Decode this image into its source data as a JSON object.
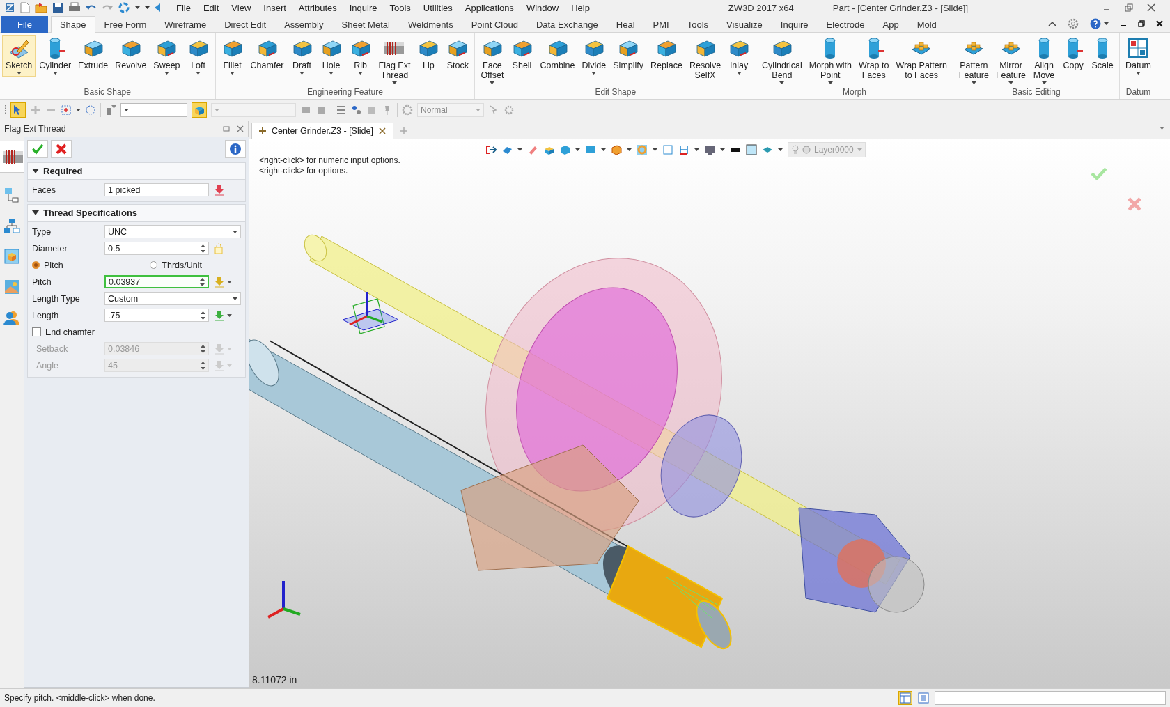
{
  "title_bar": {
    "menu": [
      "File",
      "Edit",
      "View",
      "Insert",
      "Attributes",
      "Inquire",
      "Tools",
      "Utilities",
      "Applications",
      "Window",
      "Help"
    ],
    "app_title": "ZW3D 2017  x64",
    "document_title": "Part - [Center Grinder.Z3 - [Slide]]"
  },
  "ribbon": {
    "tabs": [
      {
        "label": "File",
        "kind": "file",
        "selected": false
      },
      {
        "label": "Shape",
        "kind": "tab",
        "selected": true
      },
      {
        "label": "Free Form",
        "kind": "tab",
        "selected": false
      },
      {
        "label": "Wireframe",
        "kind": "tab",
        "selected": false
      },
      {
        "label": "Direct Edit",
        "kind": "tab",
        "selected": false
      },
      {
        "label": "Assembly",
        "kind": "tab",
        "selected": false
      },
      {
        "label": "Sheet Metal",
        "kind": "tab",
        "selected": false
      },
      {
        "label": "Weldments",
        "kind": "tab",
        "selected": false
      },
      {
        "label": "Point Cloud",
        "kind": "tab",
        "selected": false
      },
      {
        "label": "Data Exchange",
        "kind": "tab",
        "selected": false
      },
      {
        "label": "Heal",
        "kind": "tab",
        "selected": false
      },
      {
        "label": "PMI",
        "kind": "tab",
        "selected": false
      },
      {
        "label": "Tools",
        "kind": "tab",
        "selected": false
      },
      {
        "label": "Visualize",
        "kind": "tab",
        "selected": false
      },
      {
        "label": "Inquire",
        "kind": "tab",
        "selected": false
      },
      {
        "label": "Electrode",
        "kind": "tab",
        "selected": false
      },
      {
        "label": "App",
        "kind": "tab",
        "selected": false
      },
      {
        "label": "Mold",
        "kind": "tab",
        "selected": false
      }
    ],
    "groups": [
      {
        "label": "Basic Shape",
        "buttons": [
          {
            "label": "Sketch",
            "dropdown": true,
            "selected": true
          },
          {
            "label": "Cylinder",
            "dropdown": true,
            "selected": false
          },
          {
            "label": "Extrude",
            "dropdown": false,
            "selected": false
          },
          {
            "label": "Revolve",
            "dropdown": false,
            "selected": false
          },
          {
            "label": "Sweep",
            "dropdown": true,
            "selected": false
          },
          {
            "label": "Loft",
            "dropdown": true,
            "selected": false
          }
        ]
      },
      {
        "label": "Engineering Feature",
        "buttons": [
          {
            "label": "Fillet",
            "dropdown": true,
            "selected": false
          },
          {
            "label": "Chamfer",
            "dropdown": false,
            "selected": false
          },
          {
            "label": "Draft",
            "dropdown": true,
            "selected": false
          },
          {
            "label": "Hole",
            "dropdown": true,
            "selected": false
          },
          {
            "label": "Rib",
            "dropdown": true,
            "selected": false
          },
          {
            "label": "Flag Ext\nThread",
            "dropdown": true,
            "selected": false
          },
          {
            "label": "Lip",
            "dropdown": false,
            "selected": false
          },
          {
            "label": "Stock",
            "dropdown": false,
            "selected": false
          }
        ]
      },
      {
        "label": "Edit Shape",
        "buttons": [
          {
            "label": "Face\nOffset",
            "dropdown": true,
            "selected": false
          },
          {
            "label": "Shell",
            "dropdown": false,
            "selected": false
          },
          {
            "label": "Combine",
            "dropdown": false,
            "selected": false
          },
          {
            "label": "Divide",
            "dropdown": true,
            "selected": false
          },
          {
            "label": "Simplify",
            "dropdown": false,
            "selected": false
          },
          {
            "label": "Replace",
            "dropdown": false,
            "selected": false
          },
          {
            "label": "Resolve\nSelfX",
            "dropdown": false,
            "selected": false
          },
          {
            "label": "Inlay",
            "dropdown": true,
            "selected": false
          }
        ]
      },
      {
        "label": "Morph",
        "buttons": [
          {
            "label": "Cylindrical\nBend",
            "dropdown": true,
            "selected": false
          },
          {
            "label": "Morph with\nPoint",
            "dropdown": true,
            "selected": false
          },
          {
            "label": "Wrap to\nFaces",
            "dropdown": false,
            "selected": false
          },
          {
            "label": "Wrap Pattern\nto Faces",
            "dropdown": false,
            "selected": false
          }
        ]
      },
      {
        "label": "Basic Editing",
        "buttons": [
          {
            "label": "Pattern\nFeature",
            "dropdown": true,
            "selected": false
          },
          {
            "label": "Mirror\nFeature",
            "dropdown": true,
            "selected": false
          },
          {
            "label": "Align\nMove",
            "dropdown": true,
            "selected": false
          },
          {
            "label": "Copy",
            "dropdown": false,
            "selected": false
          },
          {
            "label": "Scale",
            "dropdown": false,
            "selected": false
          }
        ]
      },
      {
        "label": "Datum",
        "buttons": [
          {
            "label": "Datum",
            "dropdown": true,
            "selected": false
          }
        ]
      }
    ]
  },
  "toolbar": {
    "view_mode": "Normal"
  },
  "panel": {
    "title": "Flag Ext Thread",
    "sections": [
      {
        "title": "Required",
        "expanded": true,
        "fields": [
          {
            "kind": "pick",
            "label": "Faces",
            "value": "1 picked"
          }
        ]
      },
      {
        "title": "Thread Specifications",
        "expanded": true,
        "fields": [
          {
            "kind": "dropdown",
            "label": "Type",
            "value": "UNC",
            "disabled": false,
            "focused": false
          },
          {
            "kind": "spinner",
            "label": "Diameter",
            "value": "0.5",
            "disabled": false,
            "focused": false
          },
          {
            "kind": "radio",
            "options": [
              {
                "label": "Pitch",
                "selected": true
              },
              {
                "label": "Thrds/Unit",
                "selected": false
              }
            ]
          },
          {
            "kind": "spinner",
            "label": "Pitch",
            "value": "0.03937",
            "disabled": false,
            "focused": true
          },
          {
            "kind": "dropdown",
            "label": "Length Type",
            "value": "Custom",
            "disabled": false,
            "focused": false
          },
          {
            "kind": "spinner",
            "label": "Length",
            "value": ".75",
            "disabled": false,
            "focused": false
          },
          {
            "kind": "checkbox",
            "label": "End chamfer",
            "checked": false
          },
          {
            "kind": "spinner",
            "label": "Setback",
            "value": "0.03846",
            "disabled": true,
            "focused": false
          },
          {
            "kind": "spinner",
            "label": "Angle",
            "value": "45",
            "disabled": true,
            "focused": false
          }
        ]
      }
    ]
  },
  "viewport": {
    "tab": "Center Grinder.Z3 - [Slide]",
    "layer": "Layer0000",
    "hints": [
      "<right-click> for numeric input options.",
      "<right-click> for options."
    ],
    "distance": "8.11072 in"
  },
  "status_bar": {
    "prompt": "Specify pitch.  <middle-click> when done."
  }
}
